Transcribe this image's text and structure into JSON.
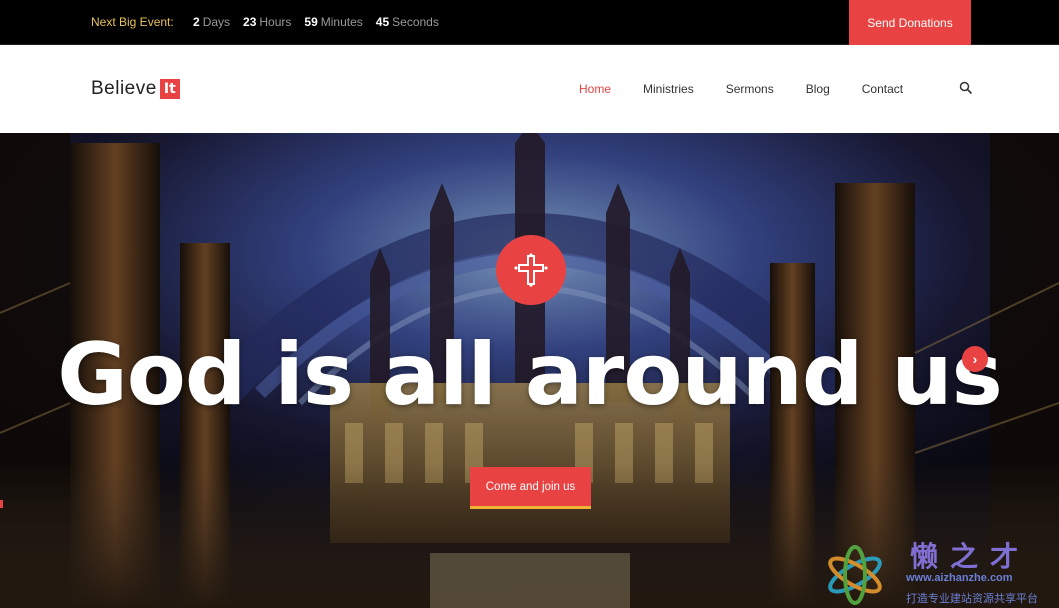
{
  "topbar": {
    "event_label": "Next Big Event:",
    "countdown": [
      {
        "value": "2",
        "unit": "Days"
      },
      {
        "value": "23",
        "unit": "Hours"
      },
      {
        "value": "59",
        "unit": "Minutes"
      },
      {
        "value": "45",
        "unit": "Seconds"
      }
    ],
    "donate_label": "Send Donations"
  },
  "header": {
    "logo_text": "Believe",
    "logo_badge": "It",
    "nav": [
      {
        "label": "Home",
        "active": true
      },
      {
        "label": "Ministries",
        "active": false
      },
      {
        "label": "Sermons",
        "active": false
      },
      {
        "label": "Blog",
        "active": false
      },
      {
        "label": "Contact",
        "active": false
      }
    ],
    "search_icon": "search-icon"
  },
  "hero": {
    "title": "God is all around us",
    "cta_label": "Come and join us",
    "cross_icon": "cross-icon",
    "next_icon": "chevron-right-icon",
    "next_glyph": "›"
  },
  "watermark": {
    "cn_title": "懒之才",
    "url": "www.aizhanzhe.com",
    "subtitle": "打造专业建站资源共享平台"
  },
  "colors": {
    "accent": "#e94242",
    "event_label": "#e7c258",
    "cta_underline": "#f2b233",
    "topbar_bg": "#000000"
  }
}
